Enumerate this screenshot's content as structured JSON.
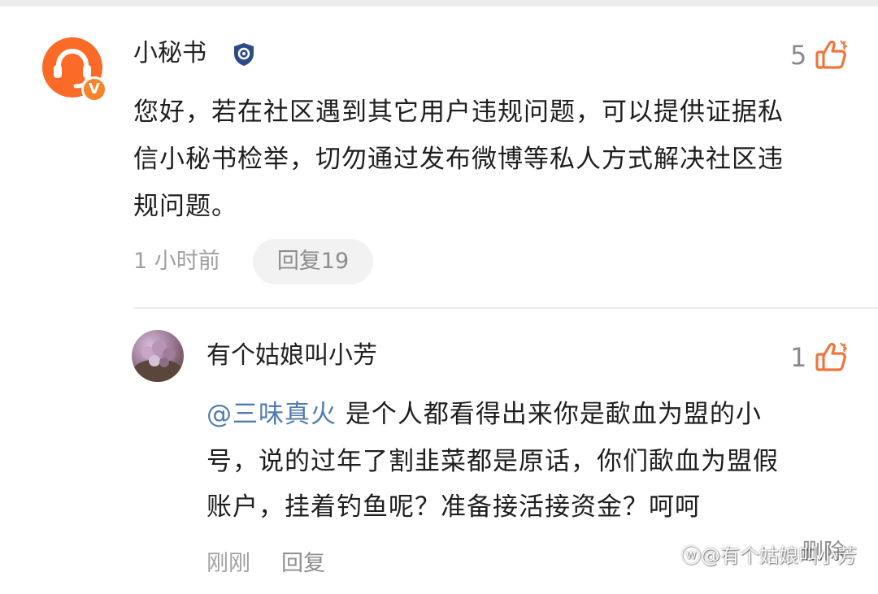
{
  "main_comment": {
    "author": "小秘书",
    "likes": "5",
    "text_lines": [
      "您好，若在社区遇到其它用户违规问题，可以提供证据私",
      "信小秘书检举，切勿通过发布微博等私人方式解决社区违",
      "规问题。"
    ],
    "time": "1 小时前",
    "reply_label": "回复19",
    "verified_badge": "V",
    "icons": [
      "customer-service-avatar-icon",
      "verified-v-icon",
      "shield-badge-icon",
      "thumbs-up-icon"
    ],
    "colors": {
      "avatar": "#fb6a26",
      "badge": "#f7832c"
    }
  },
  "reply": {
    "author": "有个姑娘叫小芳",
    "likes": "1",
    "mention": "@三味真火",
    "text_lines": [
      " 是个人都看得出来你是歃血为盟的小",
      "号，说的过年了割韭菜都是原话，你们歃血为盟假",
      "账户，挂着钓鱼呢？准备接活接资金？呵呵"
    ],
    "time": "刚刚",
    "reply_label": "回复",
    "delete_label": "删除",
    "icons": [
      "user-avatar",
      "thumbs-up-icon"
    ],
    "colors": {
      "mention": "#507daf",
      "like_icon": "#f0743a"
    }
  },
  "watermark": "@有个姑娘叫小芳"
}
